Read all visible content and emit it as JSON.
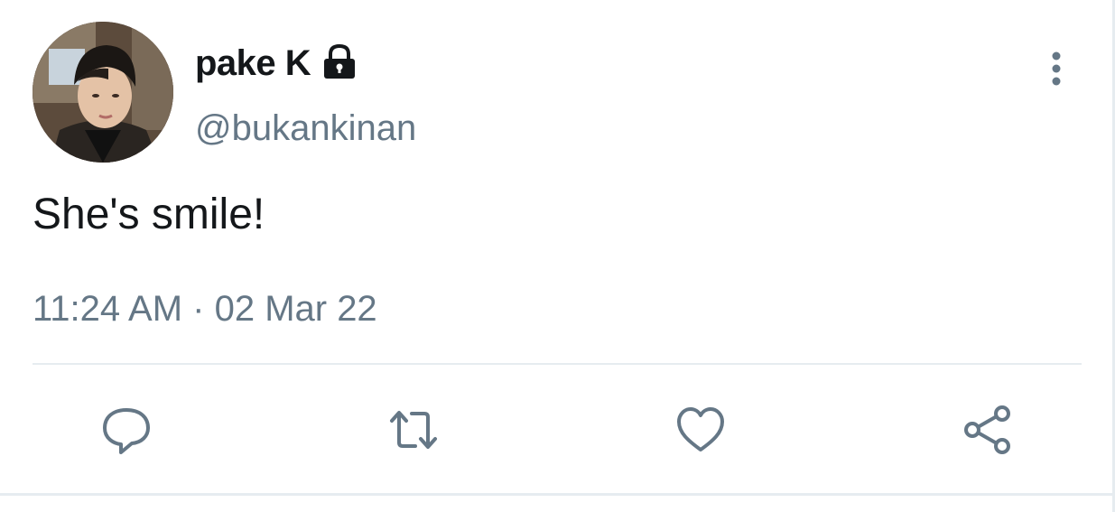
{
  "author": {
    "display_name": "pake K",
    "handle": "@bukankinan",
    "protected": true,
    "avatar": "avatar-photo"
  },
  "tweet": {
    "text": "She's smile!",
    "time": "11:24 AM",
    "separator": "·",
    "date": "02 Mar 22",
    "meta": "11:24 AM · 02 Mar 22"
  },
  "actions": [
    {
      "name": "reply",
      "icon": "reply-icon"
    },
    {
      "name": "retweet",
      "icon": "retweet-icon"
    },
    {
      "name": "like",
      "icon": "heart-icon"
    },
    {
      "name": "share",
      "icon": "share-icon"
    }
  ],
  "menu": {
    "icon": "more-vertical-icon"
  },
  "colors": {
    "text_primary": "#14171a",
    "text_secondary": "#657786",
    "icon_gray": "#657786",
    "divider": "#e6ecf0",
    "background": "#ffffff"
  }
}
